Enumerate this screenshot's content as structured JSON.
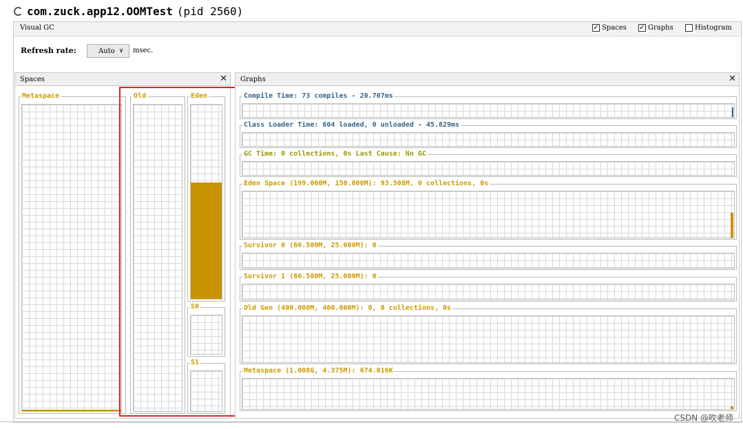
{
  "window": {
    "app_name": "com.zuck.app12.OOMTest",
    "pid_text": "(pid 2560)"
  },
  "visual_gc": {
    "tab_label": "Visual GC",
    "checkboxes": [
      {
        "label": "Spaces",
        "checked": true
      },
      {
        "label": "Graphs",
        "checked": true
      },
      {
        "label": "Histogram",
        "checked": false
      }
    ],
    "refresh_label": "Refresh rate:",
    "refresh_value": "Auto",
    "refresh_unit": "msec."
  },
  "spaces_panel": {
    "title": "Spaces",
    "metaspace_label": "Metaspace",
    "old_label": "Old",
    "eden_label": "Eden",
    "s0_label": "S0",
    "s1_label": "S1",
    "eden_fill_fraction": 0.6
  },
  "graphs_panel": {
    "title": "Graphs",
    "compile_time": "Compile Time: 73 compiles - 20.707ms",
    "class_loader_time": "Class Loader Time: 604 loaded, 0 unloaded - 45.829ms",
    "gc_time": "GC Time: 0 collections, 0s Last Cause: No GC",
    "eden_space": "Eden Space (199.000M, 150.000M): 93.508M, 0 collections, 0s",
    "survivor0": "Survivor 0 (66.500M, 25.000M): 0",
    "survivor1": "Survivor 1 (66.500M, 25.000M): 0",
    "old_gen": "Old Gen (400.000M, 400.000M): 0, 0 collections, 0s",
    "metaspace": "Metaspace (1.008G, 4.375M): 674.016K"
  },
  "colors": {
    "gold": "#cc9900",
    "highlight": "#e0231f"
  },
  "watermark": "CSDN @吹老师"
}
